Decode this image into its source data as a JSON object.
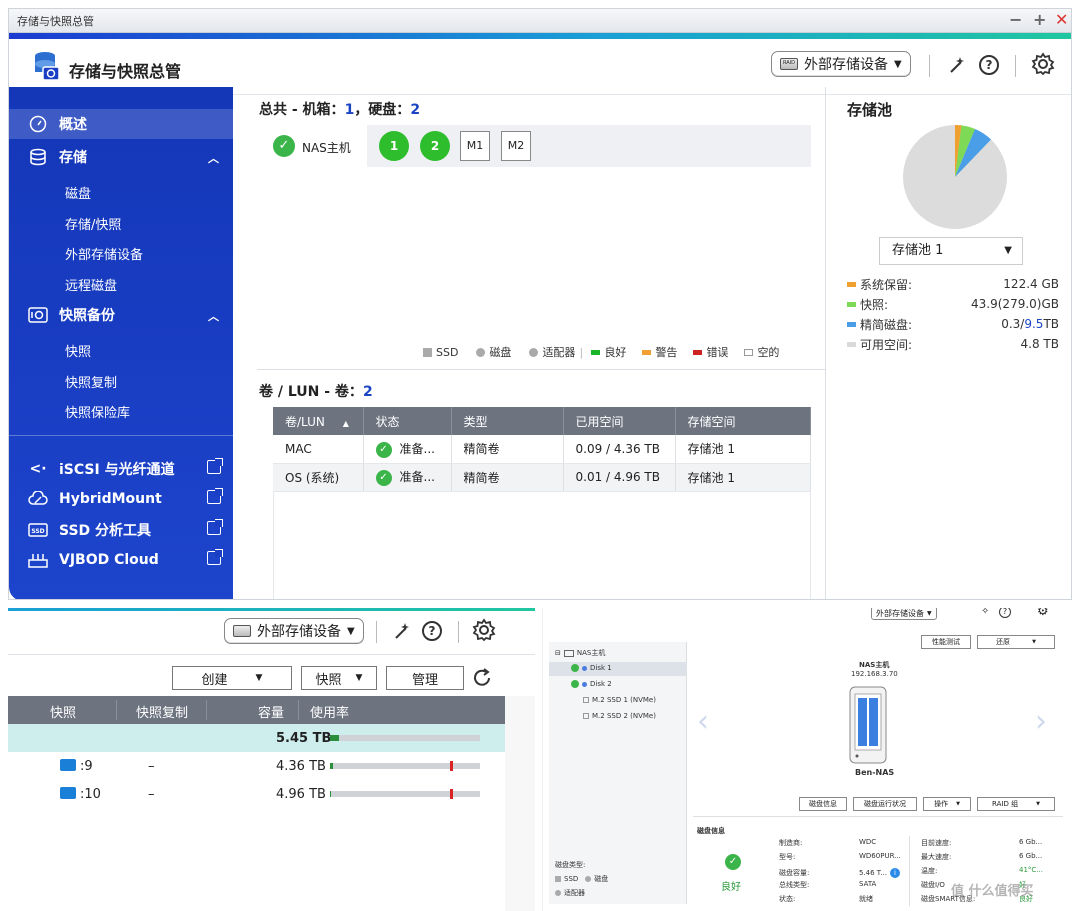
{
  "window": {
    "title": "存储与快照总管",
    "app_title": "存储与快照总管",
    "ext_storage_btn": "外部存储设备",
    "device_icon_text": "RAID"
  },
  "sidebar": {
    "overview": "概述",
    "storage": "存储",
    "storage_items": [
      "磁盘",
      "存储/快照",
      "外部存储设备",
      "远程磁盘"
    ],
    "snapshot_backup": "快照备份",
    "snapshot_items": [
      "快照",
      "快照复制",
      "快照保险库"
    ],
    "links": [
      "iSCSI 与光纤通道",
      "HybridMount",
      "SSD 分析工具",
      "VJBOD Cloud"
    ]
  },
  "overview": {
    "summary_prefix": "总共 - 机箱：",
    "enclosures": "1",
    "disk_label": "，硬盘：",
    "disks": "2",
    "nas_label": "NAS主机",
    "slots": [
      "1",
      "2",
      "M1",
      "M2"
    ],
    "legend": [
      "SSD",
      "磁盘",
      "适配器",
      "良好",
      "警告",
      "错误",
      "空的"
    ]
  },
  "volumes": {
    "title_prefix": "卷 / LUN - 卷：",
    "count": "2",
    "columns": [
      "卷/LUN",
      "状态",
      "类型",
      "已用空间",
      "存储空间"
    ],
    "rows": [
      {
        "name": "MAC",
        "status": "准备...",
        "type": "精简卷",
        "used": "0.09 / 4.36 TB",
        "pool": "存储池 1"
      },
      {
        "name": "OS (系统)",
        "status": "准备...",
        "type": "精简卷",
        "used": "0.01 / 4.96 TB",
        "pool": "存储池 1"
      }
    ]
  },
  "pool": {
    "title": "存储池",
    "selected": "存储池 1",
    "stats": [
      {
        "label": "系统保留:",
        "value": "122.4 GB",
        "color": "#f0a030"
      },
      {
        "label": "快照:",
        "value": "43.9(279.0)GB",
        "color": "#7ed957"
      },
      {
        "label": "精简磁盘:",
        "value_a": "0.3/",
        "value_b": "9.5",
        "value_c": "TB",
        "color": "#4a9ee8"
      },
      {
        "label": "可用空间:",
        "value": "4.8 TB",
        "color": "#d9d9d9"
      }
    ]
  },
  "snapshots_panel": {
    "ext_storage_btn": "外部存储设备",
    "buttons": [
      "创建",
      "快照",
      "管理"
    ],
    "columns": [
      "快照",
      "快照复制",
      "容量",
      "使用率"
    ],
    "rows": [
      {
        "name": "",
        "copy": "",
        "capacity": "5.45 TB",
        "usage": 0.06,
        "marker": null
      },
      {
        "name": ":9",
        "copy": "–",
        "capacity": "4.36 TB",
        "usage": 0.02,
        "marker": 0.8
      },
      {
        "name": ":10",
        "copy": "–",
        "capacity": "4.96 TB",
        "usage": 0.005,
        "marker": 0.8
      }
    ]
  },
  "disk_panel": {
    "ext_storage_btn": "外部存储设备",
    "tree_root": "NAS主机",
    "tree_items": [
      "Disk 1",
      "Disk 2",
      "M.2 SSD 1 (NVMe)",
      "M.2 SSD 2 (NVMe)"
    ],
    "top_buttons": [
      "性能测试",
      "还原"
    ],
    "nas_name": "NAS主机",
    "nas_ip": "192.168.3.70",
    "device_name": "Ben-NAS",
    "action_buttons": [
      "磁盘信息",
      "磁盘运行状况",
      "操作",
      "RAID 组"
    ],
    "info_title": "磁盘信息",
    "health": "良好",
    "disk_type_label": "磁盘类型:",
    "disk_types": [
      "SSD",
      "磁盘",
      "适配器"
    ],
    "info_left": [
      {
        "k": "制造商:",
        "v": "WDC"
      },
      {
        "k": "型号:",
        "v": "WD60PUR..."
      },
      {
        "k": "磁盘容量:",
        "v": "5.46 T..."
      },
      {
        "k": "总线类型:",
        "v": "SATA"
      },
      {
        "k": "状态:",
        "v": "就绪"
      }
    ],
    "info_right": [
      {
        "k": "目前速度:",
        "v": "6 Gb..."
      },
      {
        "k": "最大速度:",
        "v": "6 Gb..."
      },
      {
        "k": "温度:",
        "v": "41°C..."
      },
      {
        "k": "磁盘I/O",
        "v": "好"
      },
      {
        "k": "磁盘SMART信息:",
        "v": "良好"
      }
    ],
    "watermark": "值 什么值得买"
  },
  "colors": {
    "sidebar": "#1a3ec4",
    "accent_green": "#2dbd2d",
    "table_header": "#6d7480",
    "link_blue": "#1a44c4"
  }
}
